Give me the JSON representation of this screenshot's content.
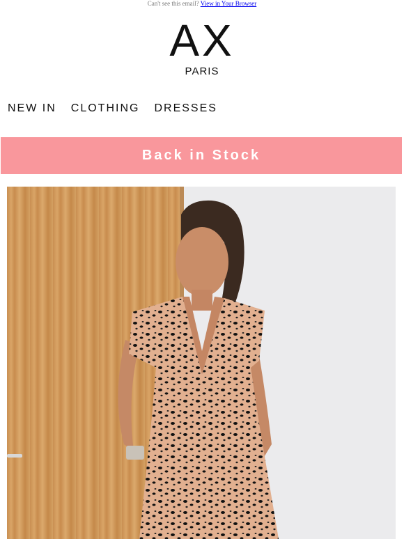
{
  "preheader": {
    "text": "Can't see this email?",
    "link_label": "View in Your Browser"
  },
  "brand": {
    "logo_mark": "AX",
    "logo_sub": "PARIS"
  },
  "nav": {
    "items": [
      {
        "label": "NEW IN"
      },
      {
        "label": "CLOTHING"
      },
      {
        "label": "DRESSES"
      }
    ]
  },
  "banner": {
    "label": "Back in Stock",
    "color": "#f9979c"
  },
  "hero": {
    "image": "woman in leopard print dress"
  }
}
